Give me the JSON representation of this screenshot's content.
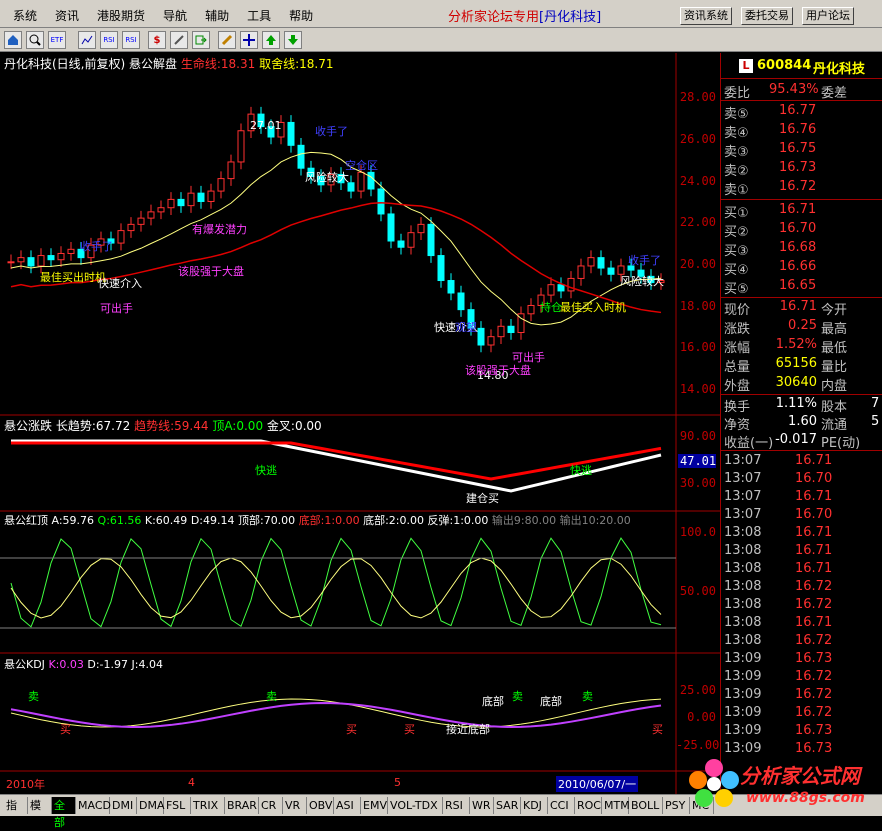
{
  "menu": {
    "items": [
      "系统",
      "资讯",
      "港股期货",
      "导航",
      "辅助",
      "工具",
      "帮助"
    ],
    "banner_prefix": "分析家论坛专用",
    "banner_brand": "[丹化科技]",
    "btn_sys": "资讯系统",
    "btn_trade": "委托交易",
    "btn_user": "用户论坛"
  },
  "toolbar": {
    "icons": [
      "home-icon",
      "zoom-icon",
      "etf-icon",
      "chart-icon",
      "rsi-icon",
      "rsi2-icon",
      "dollar-icon",
      "wrench-icon",
      "export-icon",
      "pen-icon",
      "move-icon",
      "up-arrow-icon",
      "down-arrow-icon"
    ]
  },
  "main_chart": {
    "title": "丹化科技(日线,前复权) 悬公解盘",
    "life_line_label": "生命线:18.31",
    "sell_line_label": "取舍线:18.71",
    "y_ticks": [
      "28.00",
      "26.00",
      "24.00",
      "22.00",
      "20.00",
      "18.00",
      "16.00",
      "14.00"
    ],
    "annotations": {
      "high": "27.01",
      "low": "14.80",
      "take_profit1": "收手了",
      "take_profit2": "收手了",
      "take_profit3": "收手了",
      "risk1": "风险较大",
      "risk2": "风险较大",
      "hold_zone": "空仓区",
      "best_buy1": "最佳买出时机",
      "best_buy2": "最佳买入时机",
      "quick_in1": "快速介入",
      "quick_in2": "快速介入",
      "strong_in": "有爆发潜力",
      "stronger1": "该股强于大盘",
      "stronger2": "该股强于大盘",
      "sellable1": "可出手",
      "sellable2": "可出手",
      "hold": "持仓",
      "watch": "观望"
    }
  },
  "pane2": {
    "title": "悬公涨跌",
    "long_trend": "长趋势:67.72",
    "trend_line": "趋势线:59.44",
    "top_a": "顶A:0.00",
    "golden_cross": "金叉:0.00",
    "y_ticks": [
      "90.00",
      "30.00"
    ],
    "value_box": "47.01",
    "labels": [
      "快逃",
      "快逃",
      "建仓买"
    ]
  },
  "pane3": {
    "title": "悬公红顶",
    "a": "A:59.76",
    "q": "Q:61.56",
    "k": "K:60.49",
    "d": "D:49.14",
    "top": "顶部:70.00",
    "bottom1": "底部:1:0.00",
    "bottom2": "底部:2:0.00",
    "rebound": "反弹:1:0.00",
    "out1": "输出9:80.00",
    "out2": "输出10:20.00",
    "y_ticks": [
      "100.0",
      "50.00"
    ]
  },
  "pane4": {
    "title": "悬公KDJ",
    "k": "K:0.03",
    "d": "D:-1.97",
    "j": "J:4.04",
    "y_ticks": [
      "25.00",
      "0.00",
      "-25.00"
    ],
    "labels": {
      "sell": "卖",
      "buy": "买",
      "bottom": "底部",
      "near_bottom": "接近底部"
    }
  },
  "date_axis": {
    "labels": [
      "2010年",
      "4",
      "5"
    ],
    "cursor_date": "2010/06/07/一"
  },
  "quote": {
    "code": "600844",
    "name": "丹化科技",
    "ratio_label": "委比",
    "ratio_value": "95.43%",
    "diff_label": "委差",
    "sells": [
      {
        "label": "卖⑤",
        "price": "16.77"
      },
      {
        "label": "卖④",
        "price": "16.76"
      },
      {
        "label": "卖③",
        "price": "16.75"
      },
      {
        "label": "卖②",
        "price": "16.73"
      },
      {
        "label": "卖①",
        "price": "16.72"
      }
    ],
    "buys": [
      {
        "label": "买①",
        "price": "16.71"
      },
      {
        "label": "买②",
        "price": "16.70"
      },
      {
        "label": "买③",
        "price": "16.68"
      },
      {
        "label": "买④",
        "price": "16.66"
      },
      {
        "label": "买⑤",
        "price": "16.65"
      }
    ],
    "stats": [
      {
        "l1": "现价",
        "v1": "16.71",
        "l2": "今开"
      },
      {
        "l1": "涨跌",
        "v1": "0.25",
        "l2": "最高"
      },
      {
        "l1": "涨幅",
        "v1": "1.52%",
        "l2": "最低"
      },
      {
        "l1": "总量",
        "v1": "65156",
        "l2": "量比"
      },
      {
        "l1": "外盘",
        "v1": "30640",
        "l2": "内盘"
      }
    ],
    "stats2": [
      {
        "l1": "换手",
        "v1": "1.11%",
        "l2": "股本",
        "v2": "7"
      },
      {
        "l1": "净资",
        "v1": "1.60",
        "l2": "流通",
        "v2": "5"
      },
      {
        "l1": "收益(一)",
        "v1": "-0.017",
        "l2": "PE(动)",
        "v2": ""
      }
    ],
    "ticks": [
      {
        "t": "13:07",
        "p": "16.71"
      },
      {
        "t": "13:07",
        "p": "16.70"
      },
      {
        "t": "13:07",
        "p": "16.71"
      },
      {
        "t": "13:07",
        "p": "16.70"
      },
      {
        "t": "13:08",
        "p": "16.71"
      },
      {
        "t": "13:08",
        "p": "16.71"
      },
      {
        "t": "13:08",
        "p": "16.71"
      },
      {
        "t": "13:08",
        "p": "16.72"
      },
      {
        "t": "13:08",
        "p": "16.72"
      },
      {
        "t": "13:08",
        "p": "16.71"
      },
      {
        "t": "13:08",
        "p": "16.72"
      },
      {
        "t": "13:09",
        "p": "16.73"
      },
      {
        "t": "13:09",
        "p": "16.72"
      },
      {
        "t": "13:09",
        "p": "16.72"
      },
      {
        "t": "13:09",
        "p": "16.72"
      },
      {
        "t": "13:09",
        "p": "16.73"
      },
      {
        "t": "13:09",
        "p": "16.73"
      }
    ]
  },
  "bottom_tabs": [
    "指标",
    "模板",
    "全部",
    "MACD",
    "DMI",
    "DMA",
    "FSL",
    "TRIX",
    "BRAR",
    "CR",
    "VR",
    "OBV",
    "ASI",
    "EMV",
    "VOL-TDX",
    "RSI",
    "WR",
    "SAR",
    "KDJ",
    "CCI",
    "ROC",
    "MTM",
    "BOLL",
    "PSY",
    "MC"
  ],
  "logo": {
    "text": "分析家公式网",
    "url": "www.88gs.com"
  },
  "colors": {
    "up": "#ff3030",
    "down": "#00ffff",
    "ma_yellow": "#ffff80",
    "ma_red": "#e00000",
    "bg": "#000000"
  }
}
